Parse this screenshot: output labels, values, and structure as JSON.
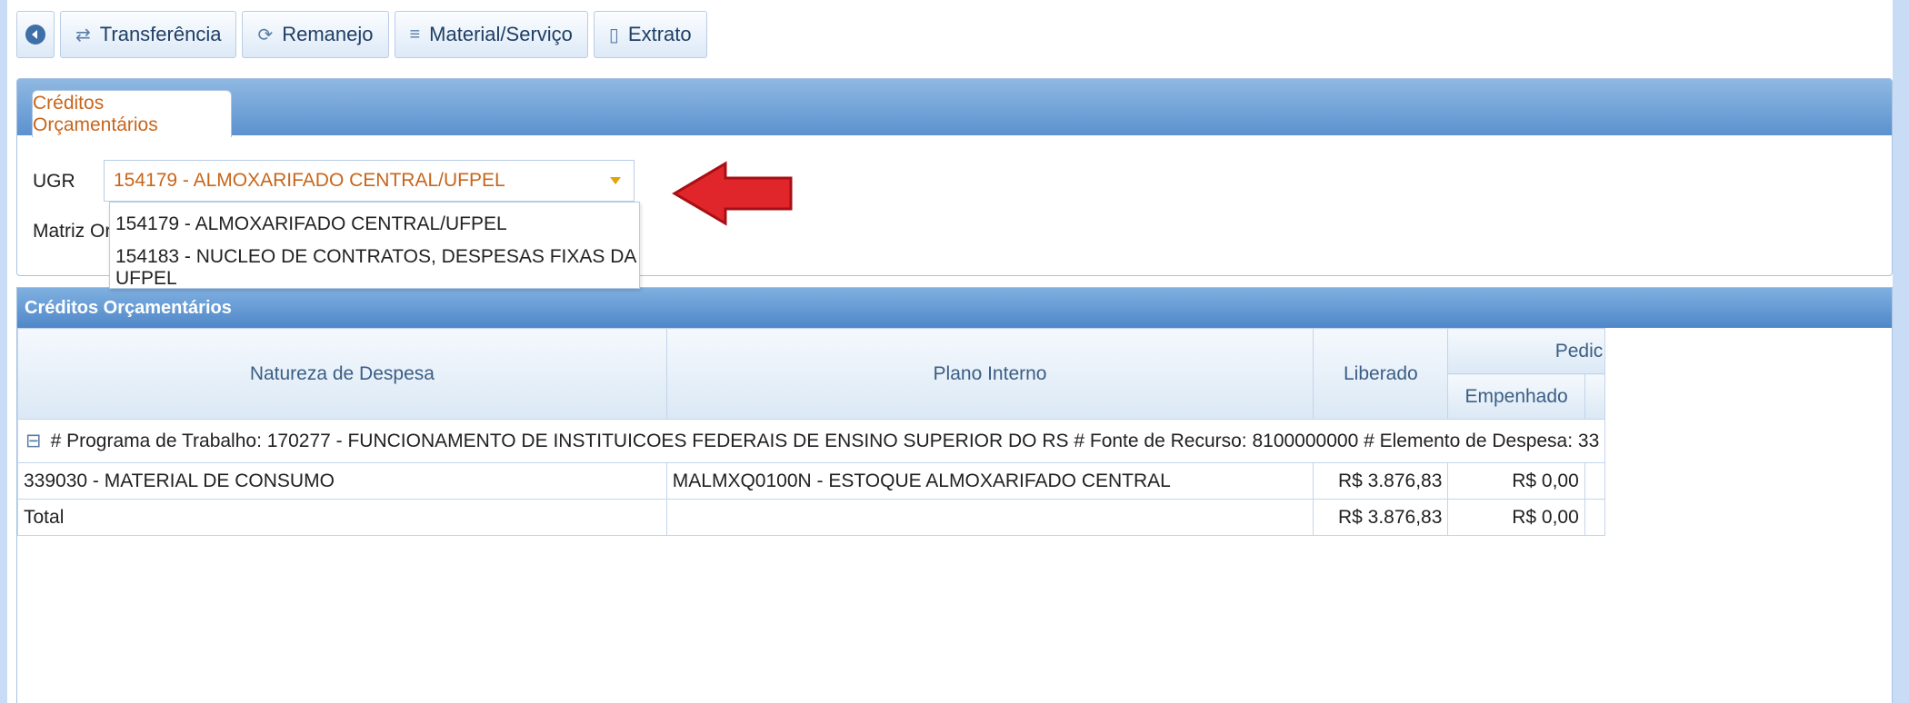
{
  "toolbar": {
    "back_icon": "circle-left-arrow-icon",
    "buttons": [
      {
        "label": "Transferência",
        "icon": "transfer-arrows-icon"
      },
      {
        "label": "Remanejo",
        "icon": "swap-circle-icon"
      },
      {
        "label": "Material/Serviço",
        "icon": "list-icon"
      },
      {
        "label": "Extrato",
        "icon": "document-icon"
      }
    ]
  },
  "panel1": {
    "tab_label": "Créditos Orçamentários",
    "ugr_label": "UGR",
    "ugr_selected": "154179 - ALMOXARIFADO CENTRAL/UFPEL",
    "matriz_label": "Matriz Orç",
    "dropdown_options": [
      "154179 - ALMOXARIFADO CENTRAL/UFPEL",
      "154183 - NUCLEO DE CONTRATOS, DESPESAS FIXAS DA UFPEL"
    ]
  },
  "annotation": {
    "arrow_color": "#e0262b"
  },
  "panel2": {
    "title": "Créditos Orçamentários",
    "columns": {
      "natureza": "Natureza de Despesa",
      "plano": "Plano Interno",
      "liberado": "Liberado",
      "pedidos": "Pedic",
      "empenhado": "Empenhado"
    },
    "group_row": "# Programa de Trabalho: 170277 - FUNCIONAMENTO DE INSTITUICOES FEDERAIS DE ENSINO SUPERIOR DO RS # Fonte de Recurso: 8100000000 # Elemento de Despesa: 33",
    "rows": [
      {
        "natureza": "339030 - MATERIAL DE CONSUMO",
        "plano": "MALMXQ0100N - ESTOQUE ALMOXARIFADO CENTRAL",
        "liberado": "R$ 3.876,83",
        "empenhado": "R$ 0,00"
      }
    ],
    "total": {
      "label": "Total",
      "liberado": "R$ 3.876,83",
      "empenhado": "R$ 0,00"
    }
  }
}
